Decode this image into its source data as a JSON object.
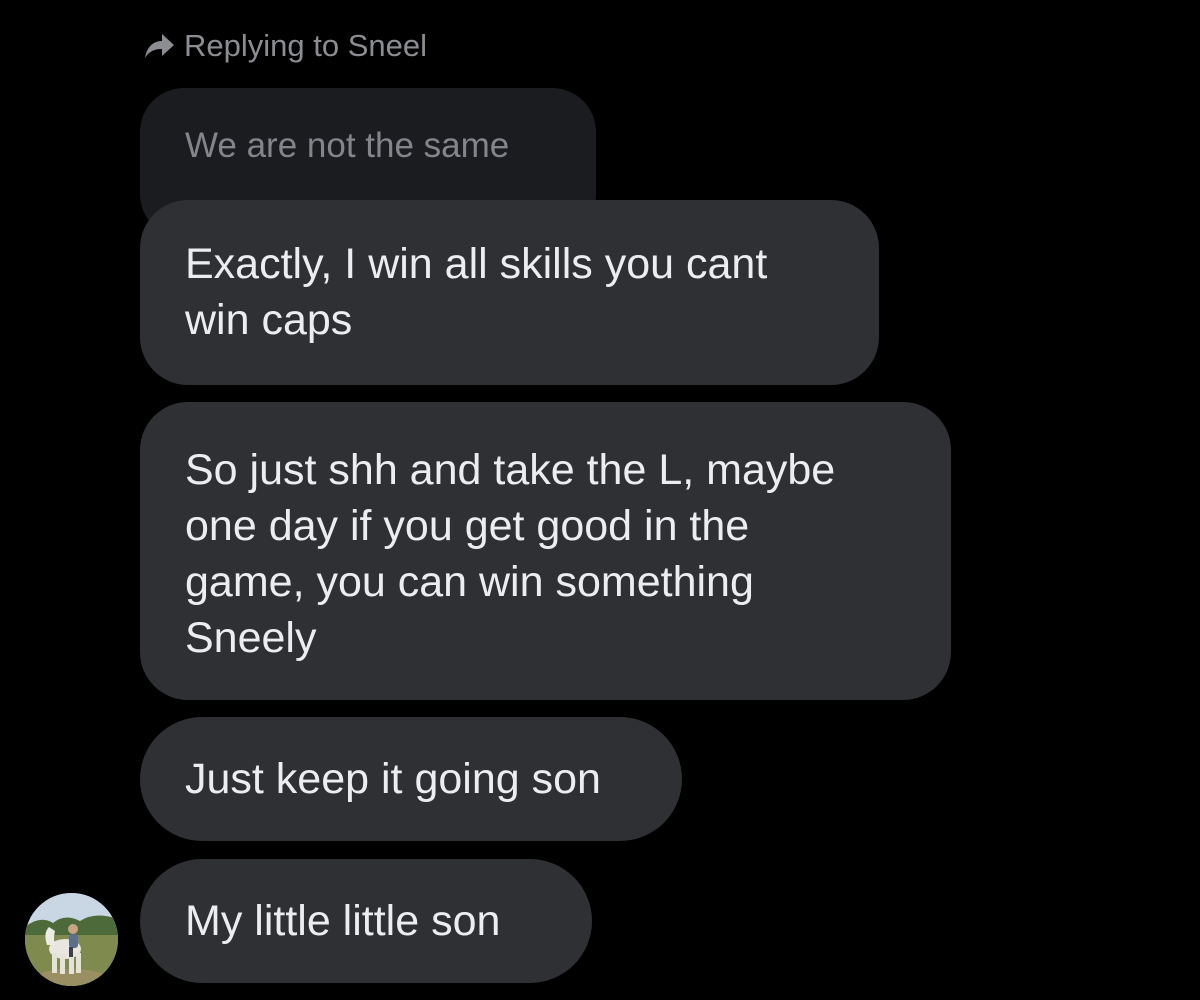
{
  "reply": {
    "label": "Replying to Sneel",
    "icon": "reply-arrow-icon"
  },
  "quoted_message": {
    "text": "We are not the same"
  },
  "messages": [
    {
      "text": "Exactly, I win all skills you cant\nwin caps"
    },
    {
      "text": "So just shh and take the L, maybe\none day if you get good in the\ngame, you can win something\nSneely"
    },
    {
      "text": "Just keep it going son"
    },
    {
      "text": "My little little son"
    }
  ],
  "colors": {
    "background": "#000000",
    "bubble": "#2f3034",
    "quoted_bubble": "#1b1c1f",
    "text": "#ecedef",
    "muted_text": "#8b8d93"
  }
}
